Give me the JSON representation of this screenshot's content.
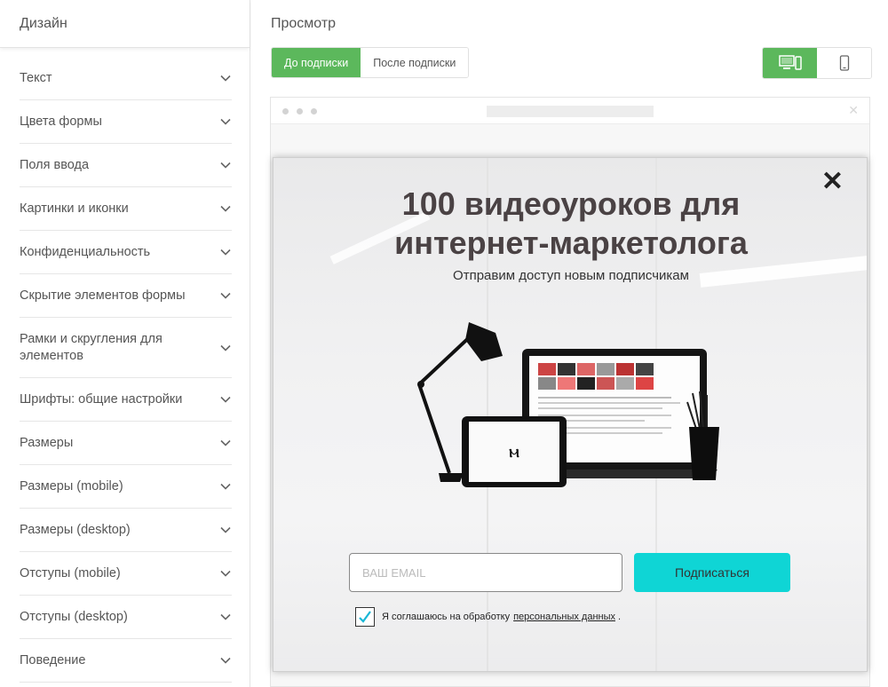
{
  "sidebar": {
    "header": "Дизайн",
    "items": [
      {
        "label": "Текст"
      },
      {
        "label": "Цвета формы"
      },
      {
        "label": "Поля ввода"
      },
      {
        "label": "Картинки и иконки"
      },
      {
        "label": "Конфиденциальность"
      },
      {
        "label": "Скрытие элементов формы"
      },
      {
        "label": "Рамки и скругления для элементов"
      },
      {
        "label": "Шрифты: общие настройки"
      },
      {
        "label": "Размеры"
      },
      {
        "label": "Размеры (mobile)"
      },
      {
        "label": "Размеры (desktop)"
      },
      {
        "label": "Отступы (mobile)"
      },
      {
        "label": "Отступы (desktop)"
      },
      {
        "label": "Поведение"
      }
    ]
  },
  "main": {
    "title": "Просмотр",
    "tabs": [
      {
        "label": "До подписки",
        "active": true
      },
      {
        "label": "После подписки",
        "active": false
      }
    ],
    "devices": [
      {
        "icon": "desktop-icon",
        "active": true
      },
      {
        "icon": "mobile-icon",
        "active": false
      }
    ]
  },
  "popup": {
    "title_line1": "100 видеоуроков для",
    "title_line2": "интернет-маркетолога",
    "subtitle": "Отправим доступ новым подписчикам",
    "email_placeholder": "ВАШ EMAIL",
    "submit_label": "Подписаться",
    "agree_text": "Я соглашаюсь на обработку",
    "agree_link": "персональных данных",
    "agree_end": ".",
    "checkbox_checked": true
  },
  "colors": {
    "accent_green": "#5cb85c",
    "submit_cyan": "#0fd5d5",
    "check_cyan": "#1ab7d6"
  }
}
